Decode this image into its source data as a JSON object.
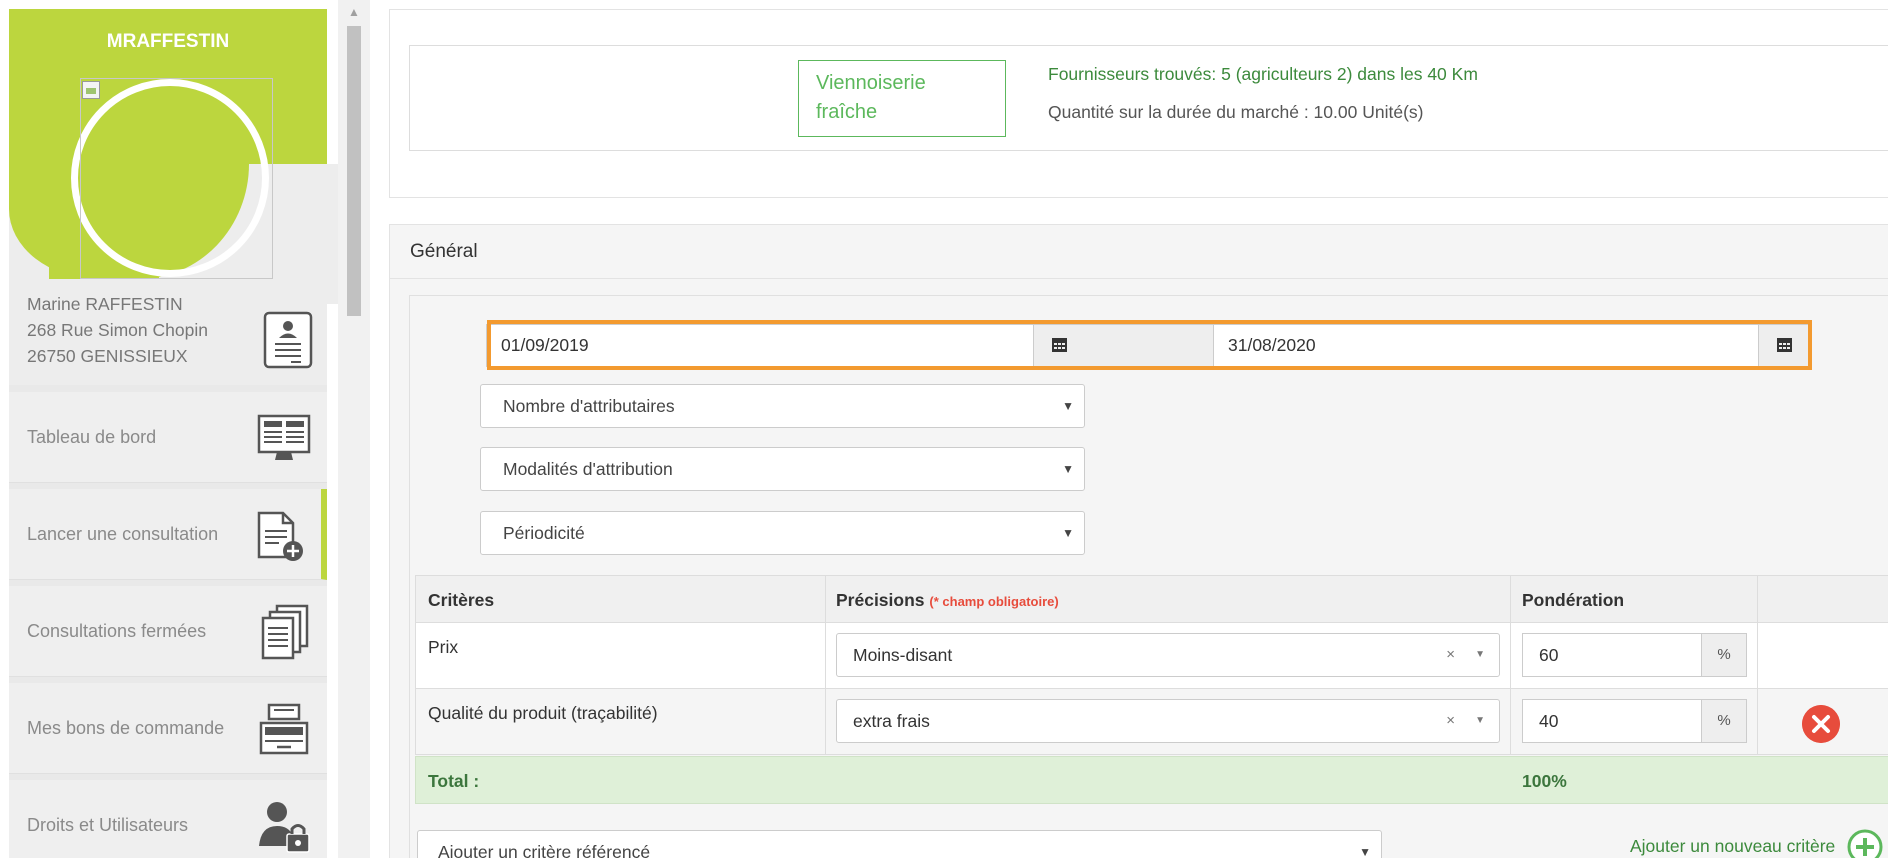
{
  "sidebar": {
    "user_login": "MRAFFESTIN",
    "address": {
      "name": "Marine RAFFESTIN",
      "street": "268 Rue Simon Chopin",
      "city": "26750 GENISSIEUX"
    },
    "items": [
      {
        "label": "Tableau de bord",
        "icon": "dashboard-icon"
      },
      {
        "label": "Lancer une consultation",
        "icon": "new-document-icon"
      },
      {
        "label": "Consultations fermées",
        "icon": "documents-stack-icon"
      },
      {
        "label": "Mes bons de commande",
        "icon": "cash-register-icon"
      },
      {
        "label": "Droits et Utilisateurs",
        "icon": "user-lock-icon"
      }
    ]
  },
  "product": {
    "name": "Viennoiserie fraîche",
    "suppliers_text": "Fournisseurs trouvés: 5 (agriculteurs 2) dans les 40 Km",
    "quantity_text": "Quantité sur la durée du marché : 10.00   Unité(s)"
  },
  "general": {
    "heading": "Général",
    "date_start": "01/09/2019",
    "date_end": "31/08/2020",
    "selects": {
      "attributaires": "Nombre d'attributaires",
      "modalites": "Modalités d'attribution",
      "periodicite": "Périodicité"
    }
  },
  "criteria": {
    "headers": {
      "criteres": "Critères",
      "precisions": "Précisions",
      "required_note": "(* champ obligatoire)",
      "ponderation": "Pondération"
    },
    "rows": [
      {
        "name": "Prix",
        "precision": "Moins-disant",
        "weight": "60"
      },
      {
        "name": "Qualité du produit (traçabilité)",
        "precision": "extra frais",
        "weight": "40"
      }
    ],
    "percent_symbol": "%",
    "clear_symbol": "×",
    "total_label": "Total :",
    "total_value": "100%"
  },
  "actions": {
    "add_ref_criterion": "Ajouter un critère référencé",
    "add_new_criterion": "Ajouter un nouveau critère"
  },
  "colors": {
    "brand_green": "#bcd63e",
    "accent_green": "#5cb85c",
    "highlight_orange": "#f39a2f",
    "danger_red": "#e74c3c"
  }
}
